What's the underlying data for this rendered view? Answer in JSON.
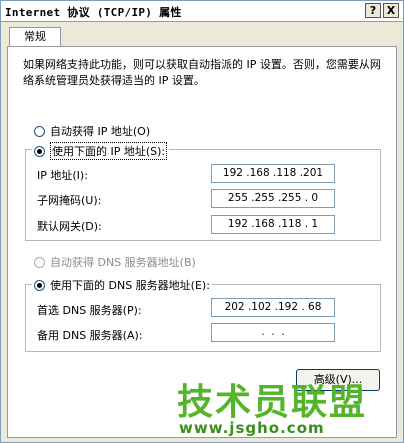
{
  "window": {
    "title": "Internet 协议 (TCP/IP) 属性",
    "help_button": "?",
    "close_button": "X"
  },
  "tabs": [
    {
      "label": "常规"
    }
  ],
  "description": "如果网络支持此功能，则可以获取自动指派的 IP 设置。否则，您需要从网络系统管理员处获得适当的 IP 设置。",
  "ip_section": {
    "auto_label": "自动获得 IP 地址(O)",
    "manual_label": "使用下面的 IP 地址(S):",
    "selected": "manual",
    "fields": [
      {
        "label": "IP 地址(I):",
        "value": "192 .168 .118 .201"
      },
      {
        "label": "子网掩码(U):",
        "value": "255 .255 .255 . 0"
      },
      {
        "label": "默认网关(D):",
        "value": "192 .168 .118 . 1"
      }
    ]
  },
  "dns_section": {
    "auto_label": "自动获得 DNS 服务器地址(B)",
    "manual_label": "使用下面的 DNS 服务器地址(E):",
    "selected": "manual",
    "fields": [
      {
        "label": "首选 DNS 服务器(P):",
        "value": "202 .102 .192 . 68"
      },
      {
        "label": "备用 DNS 服务器(A):",
        "value": " .  .  . "
      }
    ]
  },
  "advanced_button": "高级(V)...",
  "watermark": {
    "line1": "技术员联盟",
    "line2": "www.jsgho.com"
  },
  "colors": {
    "watermark_green": "#55b52a",
    "border_blue": "#7f9db9"
  }
}
